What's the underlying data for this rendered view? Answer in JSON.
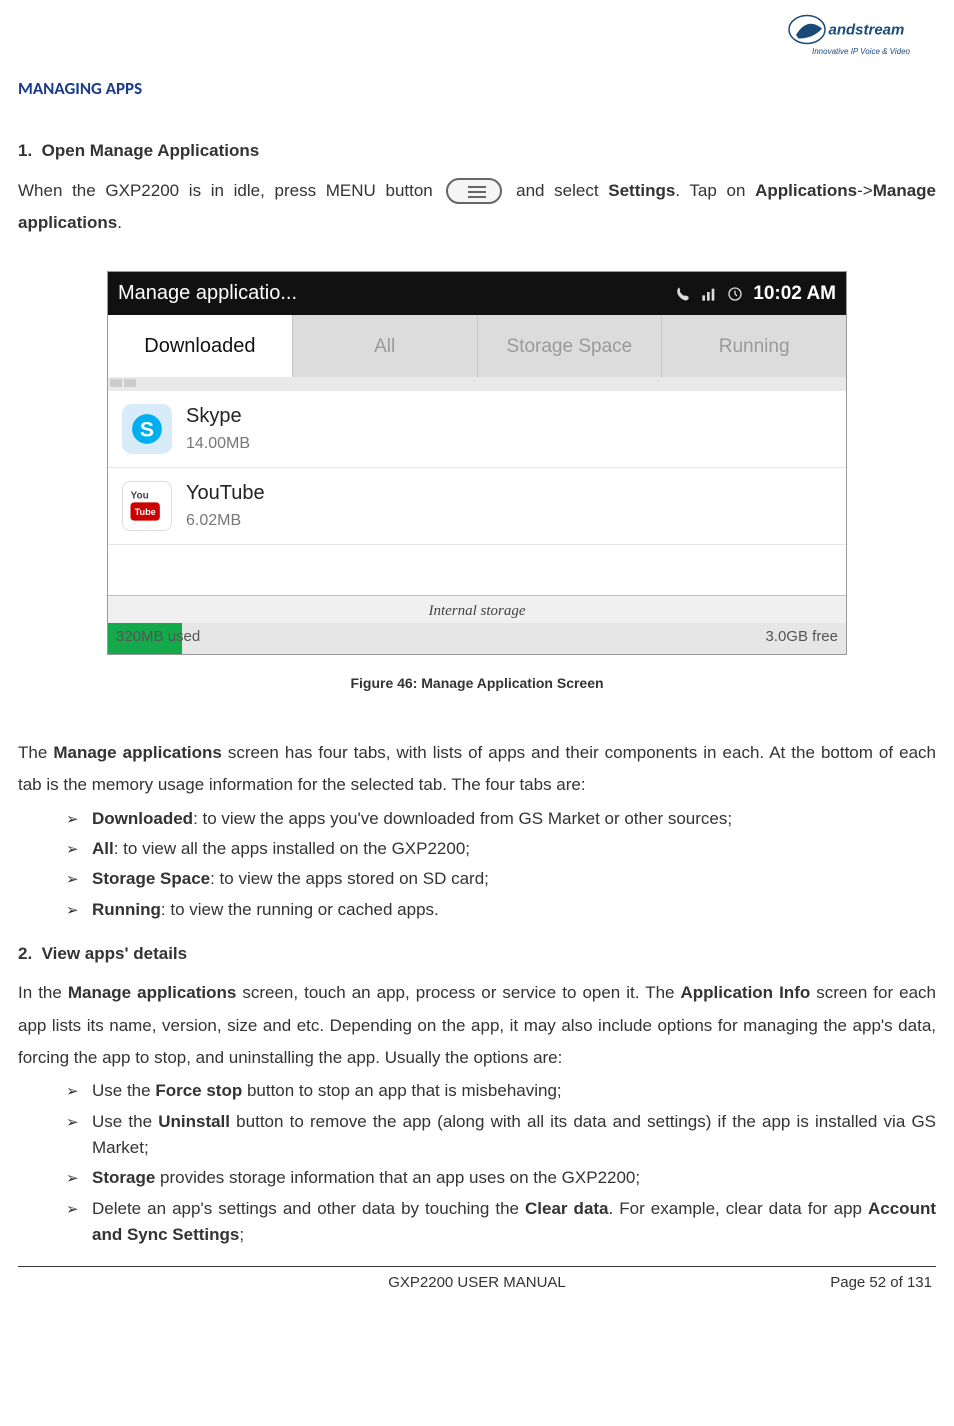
{
  "logo": {
    "tagline": "Innovative IP Voice & Video"
  },
  "section_title": "MANAGING APPS",
  "step1": {
    "number": "1.",
    "heading": "Open Manage Applications",
    "para1_pre": "When the GXP2200 is in idle, press MENU button ",
    "para1_post": " and select ",
    "settings": "Settings",
    "para1_end": ". Tap on ",
    "applications": "Applications",
    "arrow": "->",
    "manage_apps": "Manage applications",
    "period": "."
  },
  "phone": {
    "status": {
      "title": "Manage applicatio...",
      "time": "10:02 AM"
    },
    "tabs": [
      {
        "label": "Downloaded",
        "active": true
      },
      {
        "label": "All",
        "active": false
      },
      {
        "label": "Storage Space",
        "active": false
      },
      {
        "label": "Running",
        "active": false
      }
    ],
    "apps": [
      {
        "name": "Skype",
        "size": "14.00MB",
        "icon": "skype"
      },
      {
        "name": "YouTube",
        "size": "6.02MB",
        "icon": "youtube"
      }
    ],
    "storage": {
      "label": "Internal storage",
      "used": "320MB used",
      "free": "3.0GB free"
    }
  },
  "figure_caption": "Figure 46: Manage Application Screen",
  "tabs_desc": {
    "pre": "The ",
    "bold": "Manage applications",
    "post": " screen has four tabs, with lists of apps and their components in each. At the bottom of each tab is the memory usage information for the selected tab. The four tabs are:"
  },
  "tab_items": [
    {
      "bold": "Downloaded",
      "rest": ": to view the apps you've downloaded from GS Market or other sources;"
    },
    {
      "bold": "All",
      "rest": ": to view all the apps installed on the GXP2200;"
    },
    {
      "bold": "Storage Space",
      "rest": ": to view the apps stored on SD card;"
    },
    {
      "bold": "Running",
      "rest": ": to view the running or cached apps."
    }
  ],
  "step2": {
    "number": "2.",
    "heading": "View apps' details",
    "para_pre": "In the ",
    "bold1": "Manage applications",
    "mid1": " screen, touch an app, process or service to open it. The ",
    "bold2": "Application Info",
    "mid2": " screen for each app lists its name, version, size and etc. Depending on the app, it may also include options for managing the app's data, forcing the app to stop, and uninstalling the app. Usually the options are:"
  },
  "options": [
    {
      "pre": "Use the ",
      "bold": "Force stop",
      "post": " button to stop an app that is misbehaving;"
    },
    {
      "pre": "Use the ",
      "bold": "Uninstall",
      "post": " button to remove the app (along with all its data and settings) if the app is installed via GS Market;"
    },
    {
      "bold": "Storage",
      "post": " provides storage information that an app uses on the GXP2200;"
    },
    {
      "pre": "Delete an app's settings and other data by touching the ",
      "bold": "Clear data",
      "post": ". For example, clear data for app ",
      "bold2": "Account and Sync Settings",
      "post2": ";"
    }
  ],
  "footer": {
    "left": "GXP2200 USER MANUAL",
    "right": "Page 52 of 131"
  }
}
